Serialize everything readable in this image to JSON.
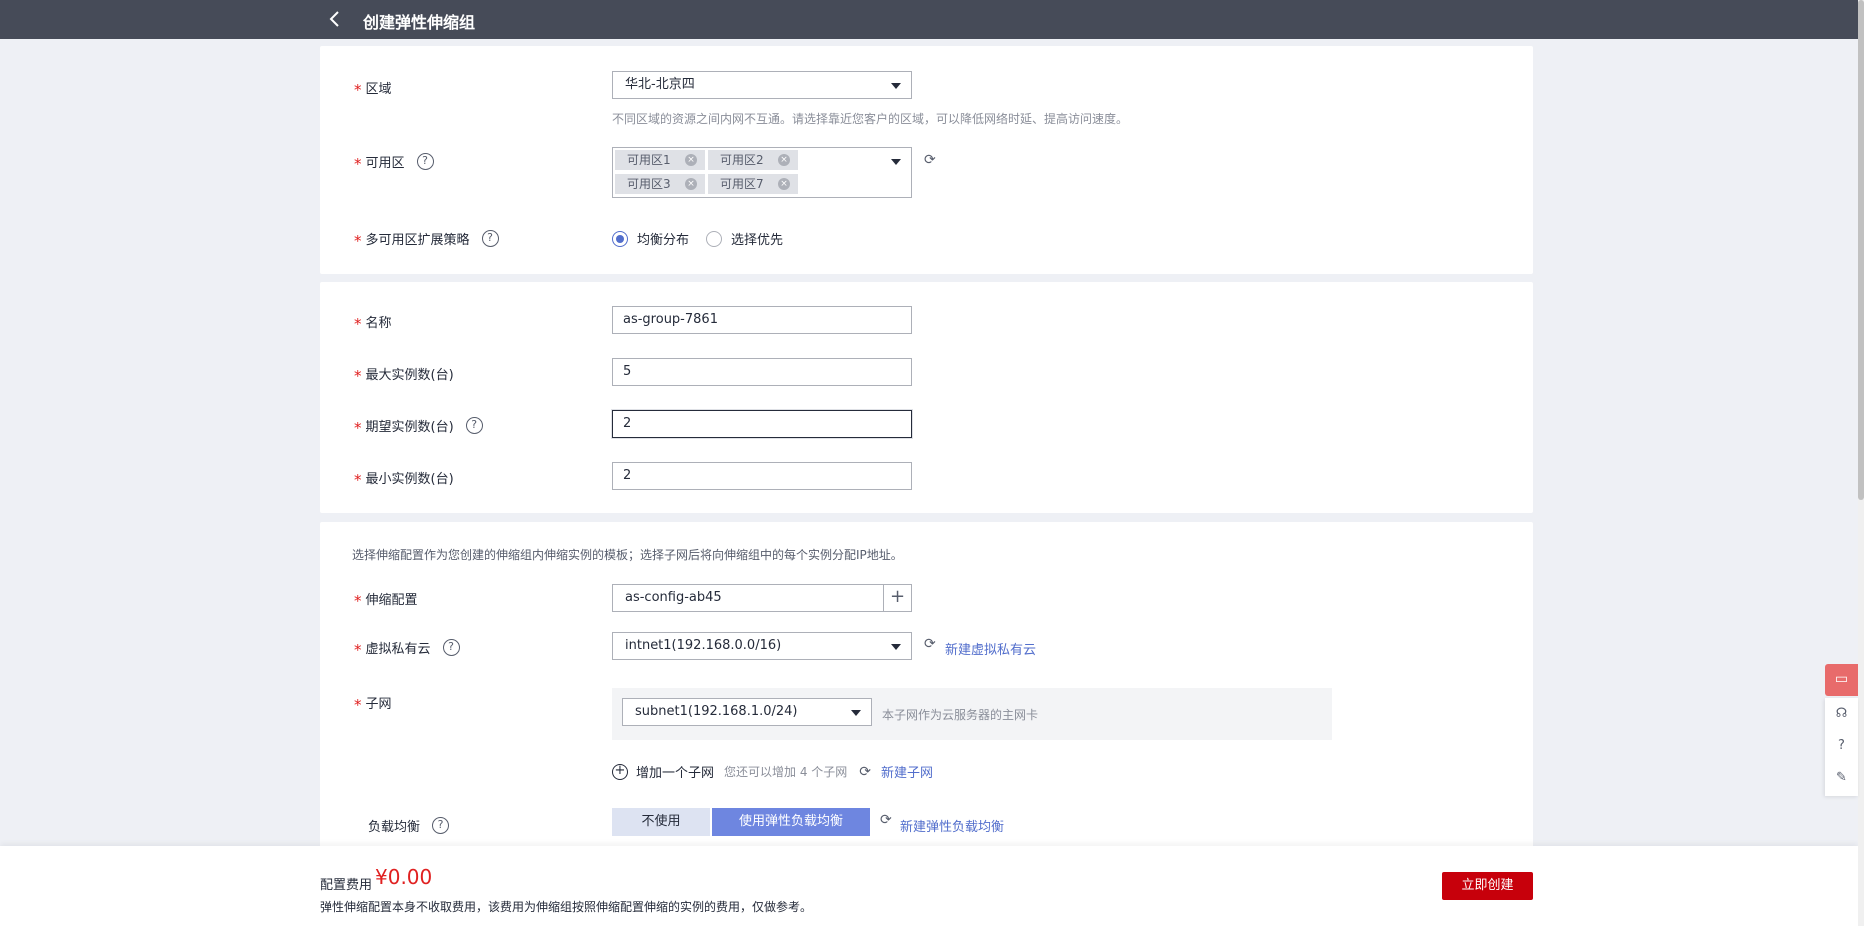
{
  "header": {
    "title": "创建弹性伸缩组"
  },
  "region": {
    "label": "区域",
    "value": "华北-北京四",
    "hint": "不同区域的资源之间内网不互通。请选择靠近您客户的区域，可以降低网络时延、提高访问速度。"
  },
  "az": {
    "label": "可用区",
    "tags": [
      "可用区1",
      "可用区2",
      "可用区3",
      "可用区7"
    ]
  },
  "az_strategy": {
    "label": "多可用区扩展策略",
    "options": [
      "均衡分布",
      "选择优先"
    ],
    "selected": "均衡分布"
  },
  "group": {
    "name_label": "名称",
    "name_value": "as-group-7861",
    "max_label": "最大实例数(台)",
    "max_value": "5",
    "desired_label": "期望实例数(台)",
    "desired_value": "2",
    "min_label": "最小实例数(台)",
    "min_value": "2"
  },
  "network": {
    "desc": "选择伸缩配置作为您创建的伸缩组内伸缩实例的模板；选择子网后将向伸缩组中的每个实例分配IP地址。",
    "config_label": "伸缩配置",
    "config_value": "as-config-ab45",
    "vpc_label": "虚拟私有云",
    "vpc_value": "intnet1(192.168.0.0/16)",
    "vpc_link": "新建虚拟私有云",
    "subnet_label": "子网",
    "subnet_value": "subnet1(192.168.1.0/24)",
    "subnet_hint": "本子网作为云服务器的主网卡",
    "add_subnet": "增加一个子网",
    "add_subnet_remaining": "您还可以增加 4 个子网",
    "new_subnet": "新建子网",
    "lb_label": "负载均衡",
    "lb_off": "不使用",
    "lb_on": "使用弹性负载均衡",
    "lb_link": "新建弹性负载均衡"
  },
  "footer": {
    "fee_label": "配置费用",
    "fee_value": "¥0.00",
    "fee_note": "弹性伸缩配置本身不收取费用，该费用为伸缩组按照伸缩配置伸缩的实例的费用，仅做参考。",
    "create": "立即创建"
  },
  "colors": {
    "accent": "#526ecc",
    "create": "#c7000b",
    "topbar": "#464b58"
  }
}
